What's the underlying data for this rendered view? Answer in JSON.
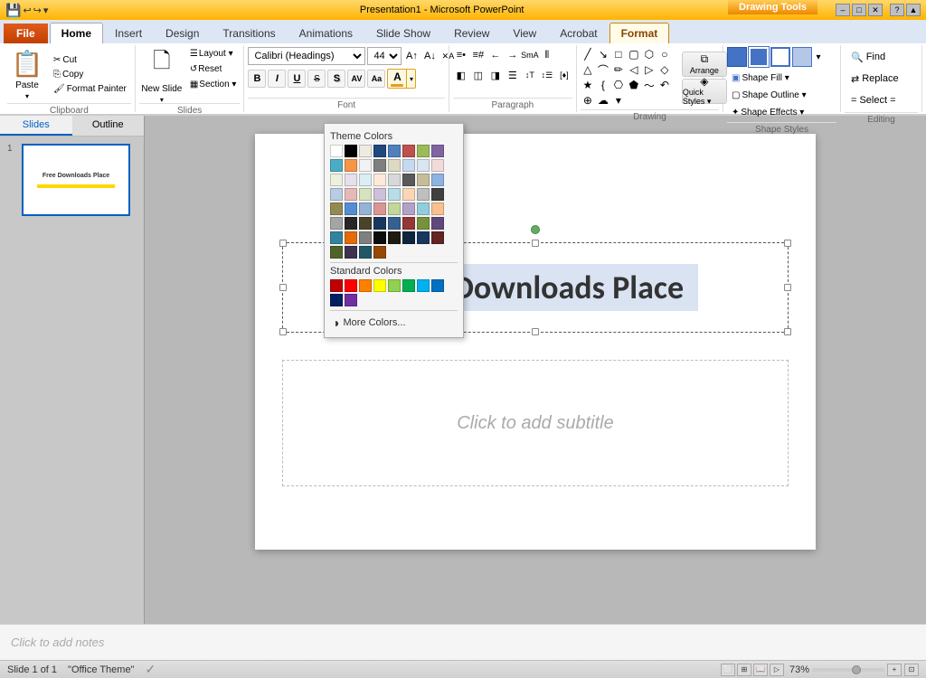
{
  "titlebar": {
    "title": "Presentation1 - Microsoft PowerPoint",
    "drawing_tools": "Drawing Tools",
    "controls": [
      "–",
      "□",
      "✕"
    ]
  },
  "tabs": {
    "items": [
      "File",
      "Home",
      "Insert",
      "Design",
      "Transitions",
      "Animations",
      "Slide Show",
      "Review",
      "View",
      "Acrobat",
      "Format"
    ],
    "active": "Home",
    "format_active": true
  },
  "ribbon": {
    "clipboard": {
      "label": "Clipboard",
      "paste_label": "Paste",
      "cut_label": "Cut",
      "copy_label": "Copy",
      "format_painter_label": "Format Painter"
    },
    "slides": {
      "label": "Slides",
      "new_slide_label": "New Slide",
      "layout_label": "Layout ▾",
      "reset_label": "Reset",
      "section_label": "Section ▾"
    },
    "font": {
      "label": "Font",
      "font_name": "Calibri (Headings)",
      "font_size": "44",
      "bold": "B",
      "italic": "I",
      "underline": "U",
      "strikethrough": "S",
      "shadow": "S",
      "char_spacing": "AV",
      "change_case": "Aa",
      "font_color": "A",
      "increase_font": "A↑",
      "decrease_font": "A↓",
      "clear_format": "✕"
    },
    "paragraph": {
      "label": "Paragraph",
      "bullets": "≡",
      "numbering": "≡#",
      "decrease_indent": "←",
      "increase_indent": "→",
      "columns": "⫴",
      "align_left": "◧",
      "align_center": "◫",
      "align_right": "◨",
      "justify": "☰",
      "more": "☰+"
    },
    "drawing": {
      "label": "Drawing",
      "arrange_label": "Arrange",
      "quick_styles_label": "Quick Styles ▾"
    },
    "shape_styles": {
      "shape_fill_label": "Shape Fill ▾",
      "shape_outline_label": "Shape Outline ▾",
      "shape_effects_label": "Shape Effects ▾"
    },
    "editing": {
      "label": "Editing",
      "find_label": "Find",
      "replace_label": "Replace",
      "select_label": "Select ="
    }
  },
  "color_picker": {
    "theme_colors_label": "Theme Colors",
    "standard_colors_label": "Standard Colors",
    "more_colors_label": "More Colors...",
    "theme_colors": [
      "#ffffff",
      "#000000",
      "#eeece1",
      "#1f497d",
      "#4f81bd",
      "#c0504d",
      "#9bbb59",
      "#8064a2",
      "#4bacc6",
      "#f79646",
      "#f2f2f2",
      "#7f7f7f",
      "#ddd9c3",
      "#c6d9f0",
      "#dbe5f1",
      "#f2dcdb",
      "#ebf1dd",
      "#e5e0ec",
      "#dbeef3",
      "#fdeada",
      "#d8d8d8",
      "#595959",
      "#c4bd97",
      "#8db3e2",
      "#b8cce4",
      "#e6b8b7",
      "#d7e3bc",
      "#ccc1d9",
      "#b7dde8",
      "#fbd5b5",
      "#bfbfbf",
      "#404040",
      "#938953",
      "#548dd4",
      "#95b3d7",
      "#d99694",
      "#c3d69b",
      "#b2a2c7",
      "#92cddc",
      "#fac08f",
      "#a5a5a5",
      "#262626",
      "#494429",
      "#17375e",
      "#366092",
      "#953734",
      "#76923c",
      "#5f497a",
      "#31849b",
      "#e36c09",
      "#7f7f7f",
      "#0c0c0c",
      "#1d1b10",
      "#0f243e",
      "#17375e",
      "#632423",
      "#4f6228",
      "#3f3151",
      "#215868",
      "#974806"
    ],
    "standard_colors": [
      "#c00000",
      "#ff0000",
      "#ff7f00",
      "#ffff00",
      "#92d050",
      "#00b050",
      "#00b0f0",
      "#0070c0",
      "#002060",
      "#7030a0"
    ]
  },
  "slide_panel": {
    "tabs": [
      "Slides",
      "Outline"
    ],
    "active_tab": "Slides",
    "slide_number": "1",
    "slide_thumb_title": "Free Downloads Place"
  },
  "slide": {
    "title": "Free Downloads Place",
    "subtitle_placeholder": "Click to add subtitle"
  },
  "notes": {
    "placeholder": "Click to add notes"
  },
  "status_bar": {
    "slide_info": "Slide 1 of 1",
    "theme": "\"Office Theme\"",
    "zoom": "73%"
  }
}
